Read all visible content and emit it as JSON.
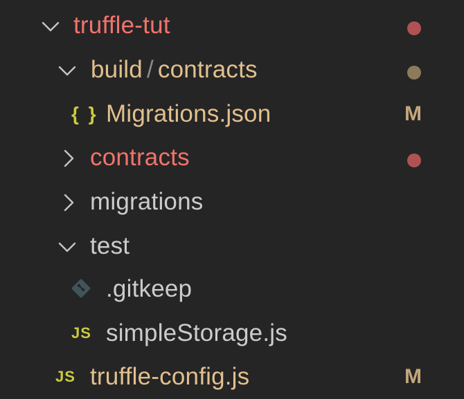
{
  "colors": {
    "background": "#252526",
    "modified_red": "#f2736b",
    "git_tan": "#e2c08d",
    "default_text": "#cccccc",
    "dot_red": "#b05252",
    "dot_tan": "#8c7a5a",
    "m_letter": "#c3a87c",
    "js_yellow": "#cbcb41",
    "json_yellow": "#cbcb41",
    "gitkeep_blue": "#41535b",
    "chevron": "#c5c5c5"
  },
  "tree": {
    "root": {
      "label": "truffle-tut",
      "expanded": true,
      "decoration": "dot",
      "icon": "chevron-down-icon"
    },
    "build": {
      "label_part1": "build",
      "separator": "/",
      "label_part2": "contracts",
      "expanded": true,
      "decoration": "dot",
      "icon": "chevron-down-icon"
    },
    "migrations_json": {
      "label": "Migrations.json",
      "file_icon_glyph": "{ }",
      "file_icon": "json-file-icon",
      "decoration": "M"
    },
    "contracts": {
      "label": "contracts",
      "expanded": false,
      "decoration": "dot",
      "icon": "chevron-right-icon"
    },
    "migrations": {
      "label": "migrations",
      "expanded": false,
      "icon": "chevron-right-icon"
    },
    "test": {
      "label": "test",
      "expanded": true,
      "icon": "chevron-down-icon"
    },
    "gitkeep": {
      "label": ".gitkeep",
      "file_icon": "git-diamond-icon"
    },
    "simple_storage": {
      "label": "simpleStorage.js",
      "file_icon_glyph": "JS",
      "file_icon": "js-file-icon"
    },
    "truffle_config": {
      "label": "truffle-config.js",
      "file_icon_glyph": "JS",
      "file_icon": "js-file-icon",
      "decoration": "M"
    }
  }
}
